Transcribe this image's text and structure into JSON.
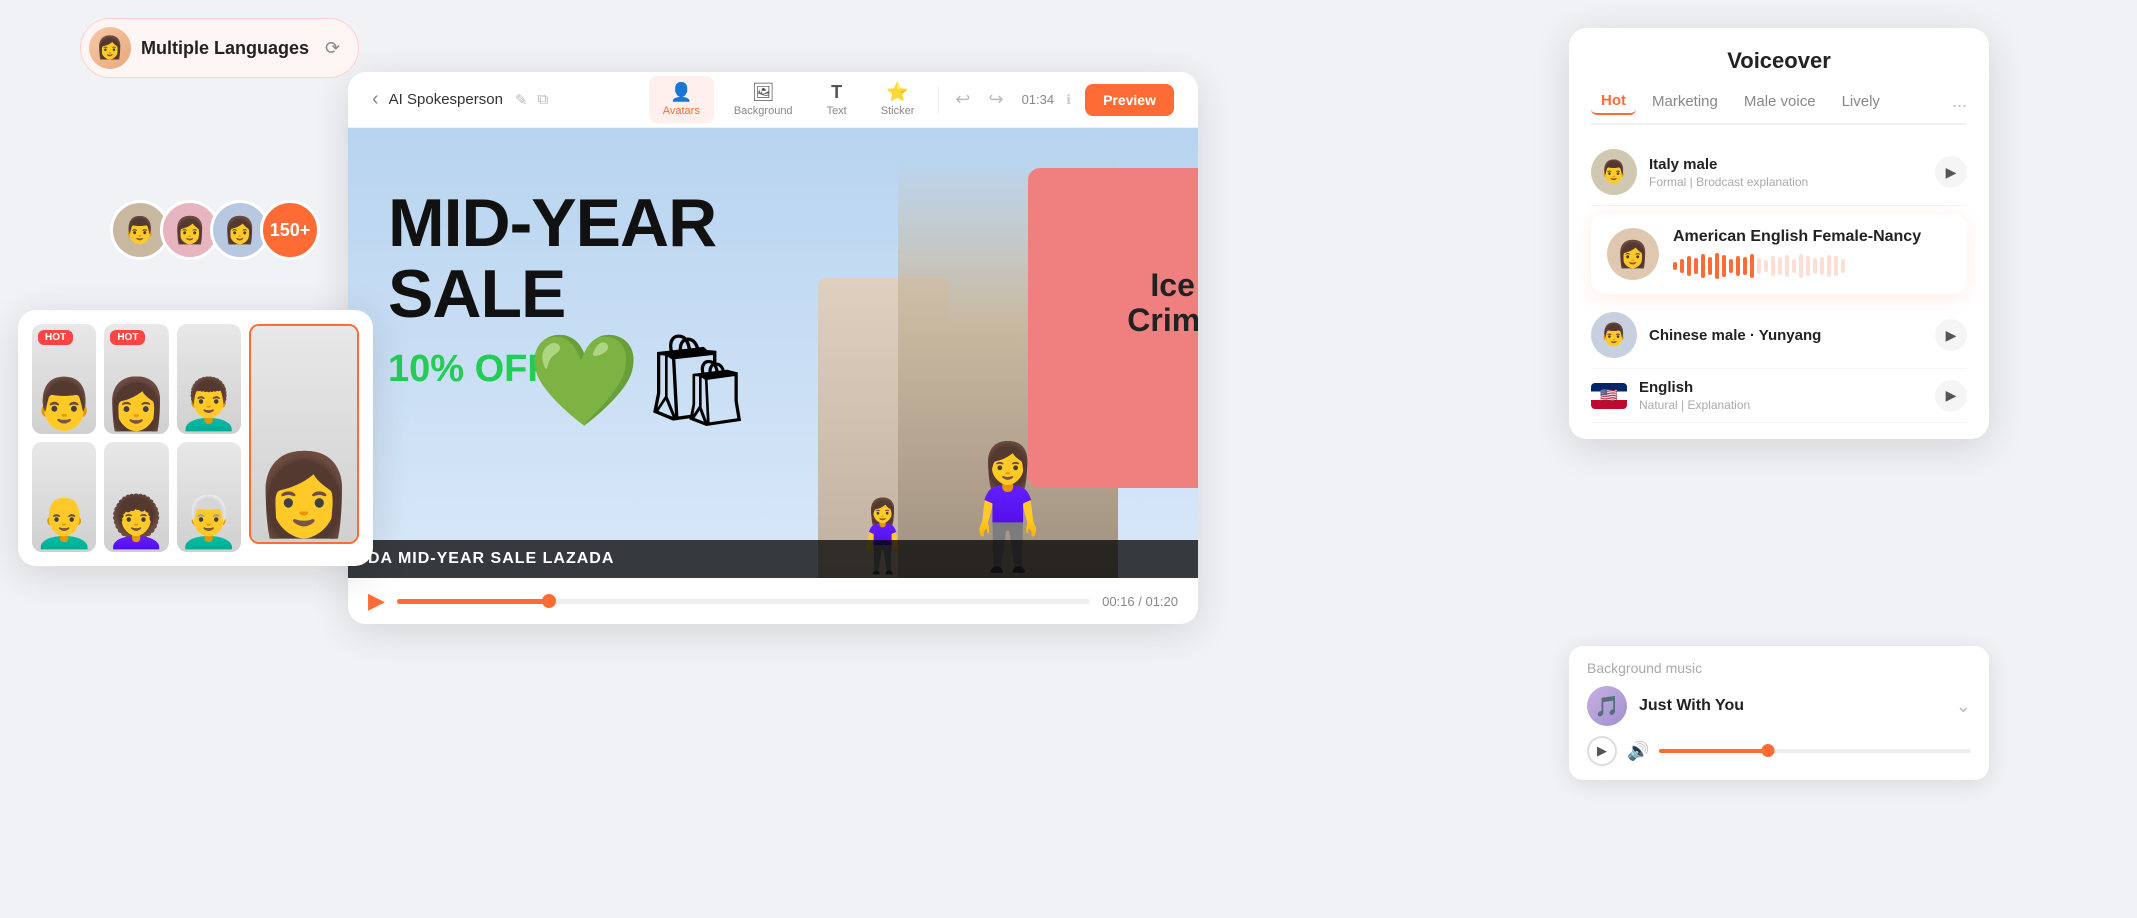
{
  "lang_badge": {
    "label": "Multiple Languages",
    "icon": "⟳"
  },
  "avatars_row": {
    "count_label": "150+"
  },
  "editor": {
    "toolbar": {
      "back_icon": "‹",
      "title": "AI Spokesperson",
      "edit_icon": "✎",
      "copy_icon": "⧉",
      "tools": [
        {
          "id": "avatars",
          "label": "Avatars",
          "icon": "👤",
          "active": true
        },
        {
          "id": "background",
          "label": "Background",
          "icon": "🖼",
          "active": false
        },
        {
          "id": "text",
          "label": "Text",
          "icon": "T",
          "active": false
        },
        {
          "id": "sticker",
          "label": "Sticker",
          "icon": "⭐",
          "active": false
        }
      ],
      "undo_icon": "↩",
      "redo_icon": "↪",
      "time": "01:34",
      "preview_label": "Preview"
    },
    "video": {
      "sale_line1": "MID-YEAR",
      "sale_line2": "SALE",
      "discount_text": "10% OFF",
      "ticker_text": "DA MID-YEAR SALE LAZADA",
      "time_current": "00:16",
      "time_total": "01:20",
      "time_display": "00:16 / 01:20"
    }
  },
  "voiceover": {
    "title": "Voiceover",
    "tabs": [
      {
        "id": "hot",
        "label": "Hot",
        "active": true
      },
      {
        "id": "marketing",
        "label": "Marketing",
        "active": false
      },
      {
        "id": "male_voice",
        "label": "Male voice",
        "active": false
      },
      {
        "id": "lively",
        "label": "Lively",
        "active": false
      },
      {
        "id": "more",
        "label": "...",
        "active": false
      }
    ],
    "voices": [
      {
        "id": "italy_male",
        "name": "Italy male",
        "desc": "Formal | Brodcast explanation",
        "avatar_emoji": "👨"
      },
      {
        "id": "american_english_female_nancy",
        "name": "American English Female-Nancy",
        "desc": "",
        "avatar_emoji": "👩",
        "featured": true
      },
      {
        "id": "chinese_male_yunyang",
        "name": "Chinese male · Yunyang",
        "desc": "",
        "avatar_emoji": "👨"
      },
      {
        "id": "english",
        "name": "English",
        "desc": "Natural | Explanation",
        "is_flag": true
      }
    ]
  },
  "bg_music": {
    "label": "Background music",
    "track_name": "Just With You",
    "thumb_emoji": "🎵"
  },
  "avatar_grid": {
    "items": [
      {
        "id": "a1",
        "hot": true,
        "emoji": "👨"
      },
      {
        "id": "a2",
        "hot": true,
        "emoji": "👩"
      },
      {
        "id": "a3",
        "hot": false,
        "emoji": "👨‍🦱"
      },
      {
        "id": "a4",
        "hot": false,
        "emoji": "👨‍🦲"
      },
      {
        "id": "a5",
        "hot": false,
        "emoji": "👩‍🦱"
      },
      {
        "id": "a6",
        "hot": false,
        "emoji": "👨‍🦳"
      }
    ],
    "selected": {
      "emoji": "👩"
    }
  },
  "waveform_heights": [
    8,
    14,
    20,
    16,
    24,
    18,
    26,
    22,
    14,
    20,
    18,
    24,
    16,
    12,
    20,
    18,
    22,
    14,
    24,
    20,
    16,
    18,
    22,
    20,
    14
  ]
}
